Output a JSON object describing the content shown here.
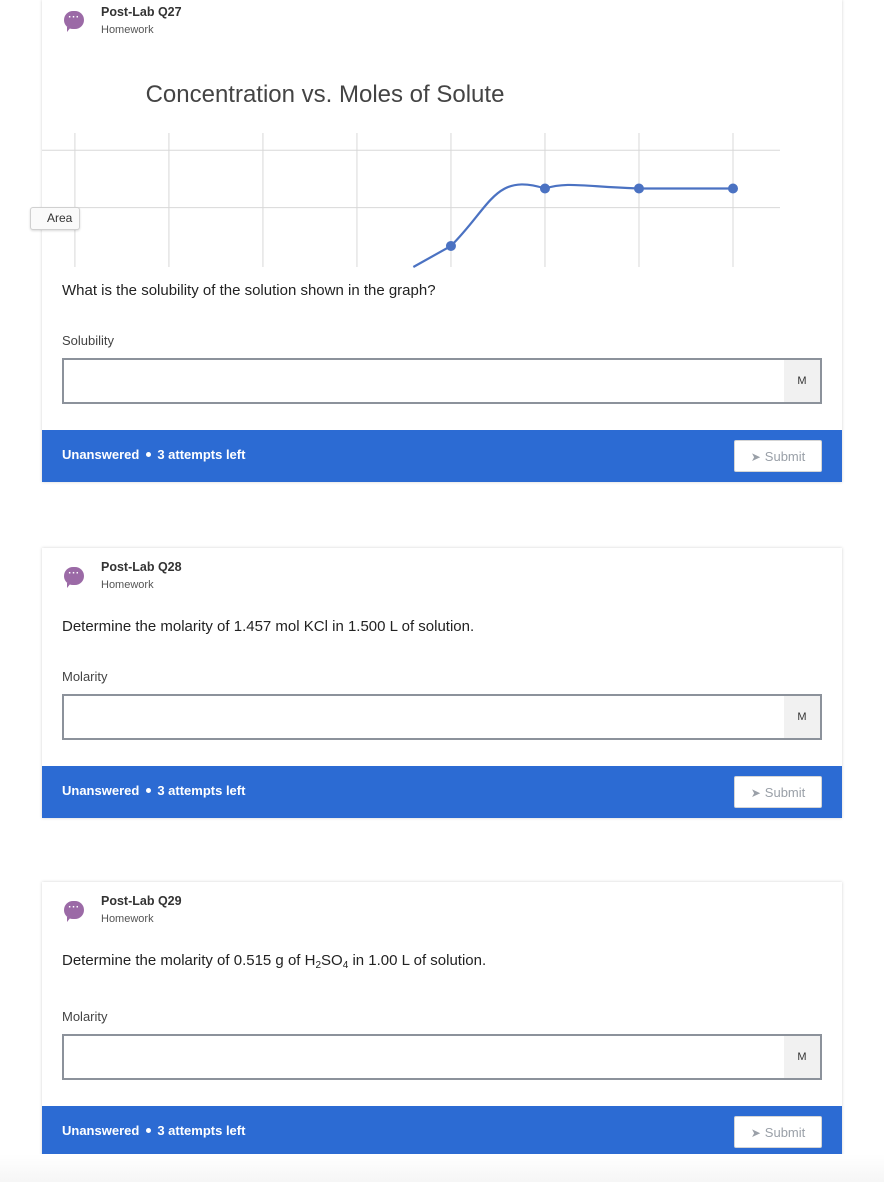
{
  "cards": [
    {
      "title": "Post-Lab Q27",
      "subtitle": "Homework",
      "question": "What is the solubility of the solution shown in the graph?",
      "field_label": "Solubility",
      "unit": "M",
      "status": "Unanswered",
      "attempts": "3 attempts left",
      "submit_label": "Submit"
    },
    {
      "title": "Post-Lab Q28",
      "subtitle": "Homework",
      "question": "Determine the molarity of 1.457 mol KCl in 1.500 L of solution.",
      "field_label": "Molarity",
      "unit": "M",
      "status": "Unanswered",
      "attempts": "3 attempts left",
      "submit_label": "Submit"
    },
    {
      "title": "Post-Lab Q29",
      "subtitle": "Homework",
      "question_parts": {
        "before": "Determine the molarity of 0.515 g of H",
        "sub1": "2",
        "middle": "SO",
        "sub2": "4",
        "after": " in 1.00 L of solution."
      },
      "field_label": "Molarity",
      "unit": "M",
      "status": "Unanswered",
      "attempts": "3 attempts left",
      "submit_label": "Submit"
    }
  ],
  "area_chip": {
    "label": "Area"
  },
  "chart_data": {
    "type": "line",
    "title": "Concentration vs. Moles of Solute",
    "xlabel": "",
    "ylabel": "",
    "grid": true,
    "line_color": "#4b72c2",
    "grid_color": "#d8d8d8",
    "x": [
      4,
      5,
      6,
      7
    ],
    "y": [
      3.5,
      5,
      5,
      5
    ],
    "curve_start": [
      3.6,
      2.95
    ],
    "xlim": [
      -0.35,
      7.5
    ],
    "ylim": [
      2.95,
      6.45
    ]
  }
}
